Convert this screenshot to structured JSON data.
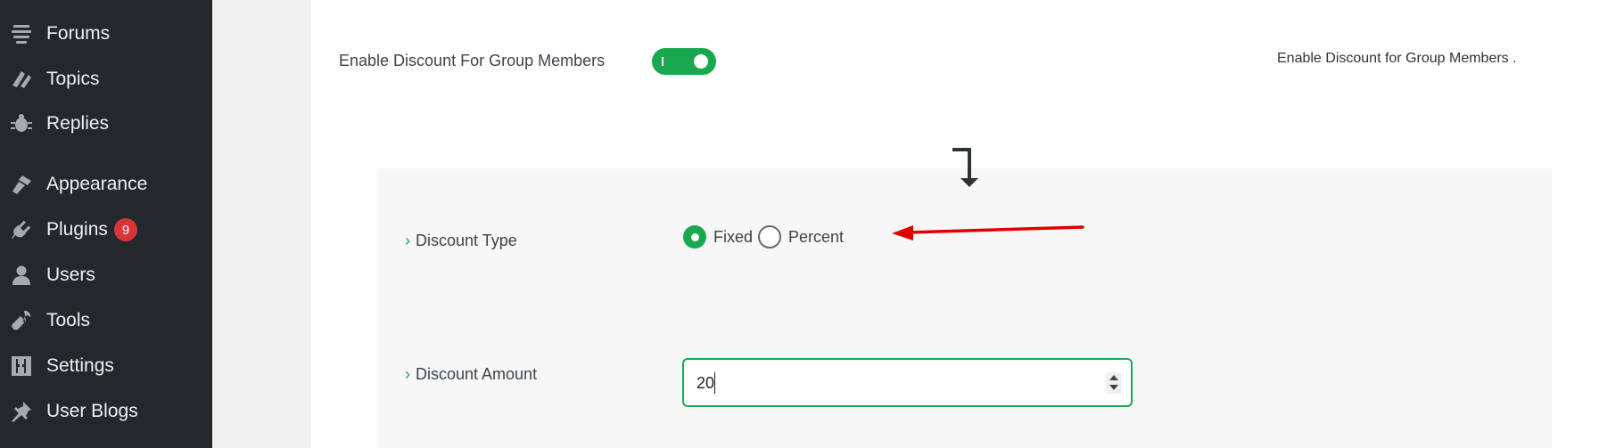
{
  "sidebar": {
    "items": [
      {
        "label": "Forums",
        "icon": "forums-icon"
      },
      {
        "label": "Topics",
        "icon": "topics-icon"
      },
      {
        "label": "Replies",
        "icon": "replies-icon"
      },
      {
        "label": "Appearance",
        "icon": "appearance-icon"
      },
      {
        "label": "Plugins",
        "icon": "plugins-icon",
        "badge": "9"
      },
      {
        "label": "Users",
        "icon": "users-icon"
      },
      {
        "label": "Tools",
        "icon": "tools-icon"
      },
      {
        "label": "Settings",
        "icon": "settings-icon"
      },
      {
        "label": "User Blogs",
        "icon": "user-blogs-icon"
      }
    ]
  },
  "settings": {
    "enable_discount": {
      "label": "Enable Discount For Group Members",
      "enabled": true,
      "help": "Enable Discount for Group Members ."
    },
    "discount_type": {
      "label": "Discount Type",
      "options": [
        {
          "label": "Fixed",
          "checked": true
        },
        {
          "label": "Percent",
          "checked": false
        }
      ]
    },
    "discount_amount": {
      "label": "Discount Amount",
      "value": "20"
    }
  },
  "colors": {
    "accent": "#19a84f",
    "sidebar_bg": "#23282d",
    "badge": "#d63638",
    "annotation_arrow": "#e00000"
  }
}
